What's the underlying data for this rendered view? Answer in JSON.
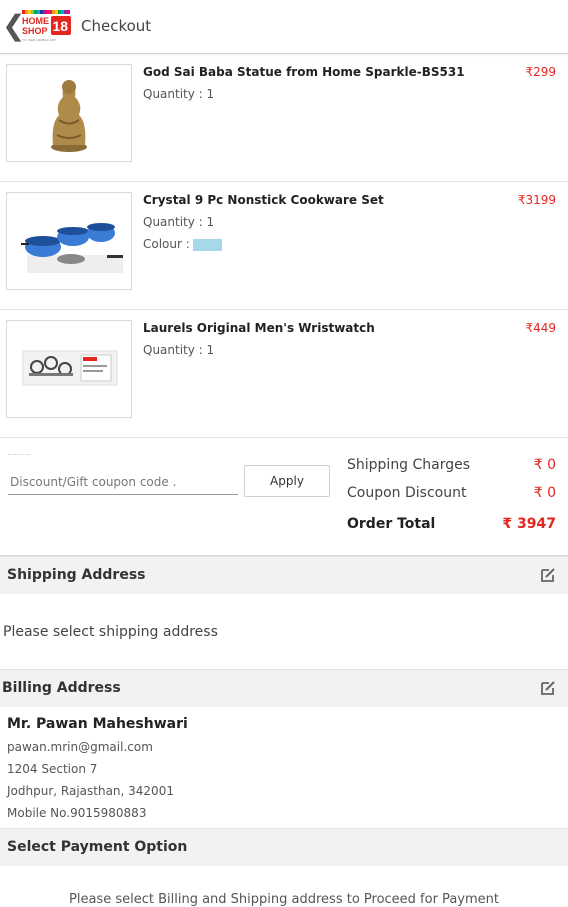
{
  "header": {
    "title": "Checkout",
    "logo_text_top": "HOME",
    "logo_text_bottom": "SHOP",
    "logo_number": "18",
    "logo_tagline": "TV | WEB | MOBILE APP"
  },
  "cart_items": [
    {
      "name": "God Sai Baba Statue from Home Sparkle-BS531",
      "price": "₹299",
      "quantity": "Quantity : 1",
      "image_icon": "statue-image"
    },
    {
      "name": "Crystal 9 Pc Nonstick Cookware Set",
      "price": "₹3199",
      "quantity": "Quantity : 1",
      "colour_label": "Colour :",
      "colour_hex": "#a7d8ea",
      "image_icon": "cookware-image"
    },
    {
      "name": "Laurels Original Men's Wristwatch",
      "price": "₹449",
      "quantity": "Quantity : 1",
      "image_icon": "wristwatch-image"
    }
  ],
  "coupon": {
    "placeholder": "Discount/Gift coupon code .",
    "apply_label": "Apply"
  },
  "summary": {
    "shipping_label": "Shipping Charges",
    "shipping_value": "₹ 0",
    "coupon_label": "Coupon Discount",
    "coupon_value": "₹ 0",
    "total_label": "Order Total",
    "total_value": "₹ 3947"
  },
  "shipping": {
    "title": "Shipping Address",
    "message": "Please select shipping address"
  },
  "billing": {
    "title": "Billing Address",
    "name": "Mr. Pawan Maheshwari",
    "email": "pawan.mrin@gmail.com",
    "line1": "1204 Section 7",
    "line2": "Jodhpur, Rajasthan, 342001",
    "mobile": "Mobile No.9015980883"
  },
  "payment": {
    "title": "Select Payment Option",
    "message": "Please select Billing and Shipping address to Proceed for Payment"
  },
  "colors": {
    "accent_red": "#e3261f",
    "section_bg": "#f2f2f2"
  }
}
